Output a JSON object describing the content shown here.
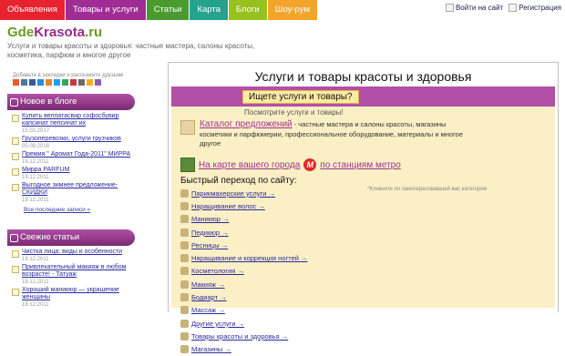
{
  "nav": {
    "tabs": [
      {
        "label": "Объявления",
        "color": "#e8222e"
      },
      {
        "label": "Товары и услуги",
        "color": "#a02d96"
      },
      {
        "label": "Статьи",
        "color": "#4a9b2f"
      },
      {
        "label": "Карта",
        "color": "#24a28e"
      },
      {
        "label": "Блоги",
        "color": "#96c11f"
      },
      {
        "label": "Шоу-рум",
        "color": "#f3a42a"
      }
    ]
  },
  "auth": {
    "login": "Войти на сайт",
    "register": "Регистрация"
  },
  "logo": {
    "part1": "Gde",
    "part2": "Krasota",
    "part3": ".ru"
  },
  "tagline": "Услуги и товары красоты и здоровья: частные мастера, салоны красоты, косметика, парфюм и многое другое",
  "share": {
    "label": "Добавьте в закладки и расскажите друзьям"
  },
  "blog": {
    "title": "Новое в блоге",
    "items": [
      {
        "text": "Купить велпатасвир софосбувир капсинат пепсинат их",
        "date": "15.03.2017"
      },
      {
        "text": "Грузоперевозки, услуги грузчиков",
        "date": "05.09.2016"
      },
      {
        "text": "Премия \" Аромат Года-2011\" МИРРА",
        "date": "19.12.2011"
      },
      {
        "text": "Мирра PARFUM",
        "date": "19.12.2011"
      },
      {
        "text": "Выгодное зимнее предложение-СКИДКИ",
        "date": "19.12.2011"
      }
    ],
    "all": "Все последние записи »"
  },
  "articles": {
    "title": "Свежие статьи",
    "items": [
      {
        "text": "Чистка лица: виды и особенности",
        "date": "19.12.2011"
      },
      {
        "text": "Привлекательный макияж в любом возрасте! - Татуаж",
        "date": "19.12.2011"
      },
      {
        "text": "Хороший маникюр — украшение женщины",
        "date": "18.12.2011"
      }
    ]
  },
  "main": {
    "title": "Услуги и товары красоты и здоровья",
    "search_button": "Ищете услуги и товары?",
    "subtitle": "Посмотрите услуги и товары!",
    "catalog_link": "Каталог предложений",
    "catalog_text": " - частные мастера и салоны красоты, магазины косметики и парфюмерии, профессиональное оборудование, материалы и многое другое",
    "map_link": "На карте вашего города",
    "metro_icon": "М",
    "metro_link": "по станциям метро",
    "quick_title": "Быстрый переход по сайту:",
    "quick_note": "*Кликните по заинтересовавшей вас категории",
    "quick_links": [
      "Парикмахерские услуги →",
      "Наращивание волос →",
      "Маникюр →",
      "Педикюр →",
      "Ресницы →",
      "Наращивание и коррекция ногтей →",
      "Косметология →",
      "Макияж →",
      "Бодиарт →",
      "Массаж →",
      "Другие услуги →",
      "Товары красоты и здоровья →",
      "Магазины →"
    ]
  }
}
